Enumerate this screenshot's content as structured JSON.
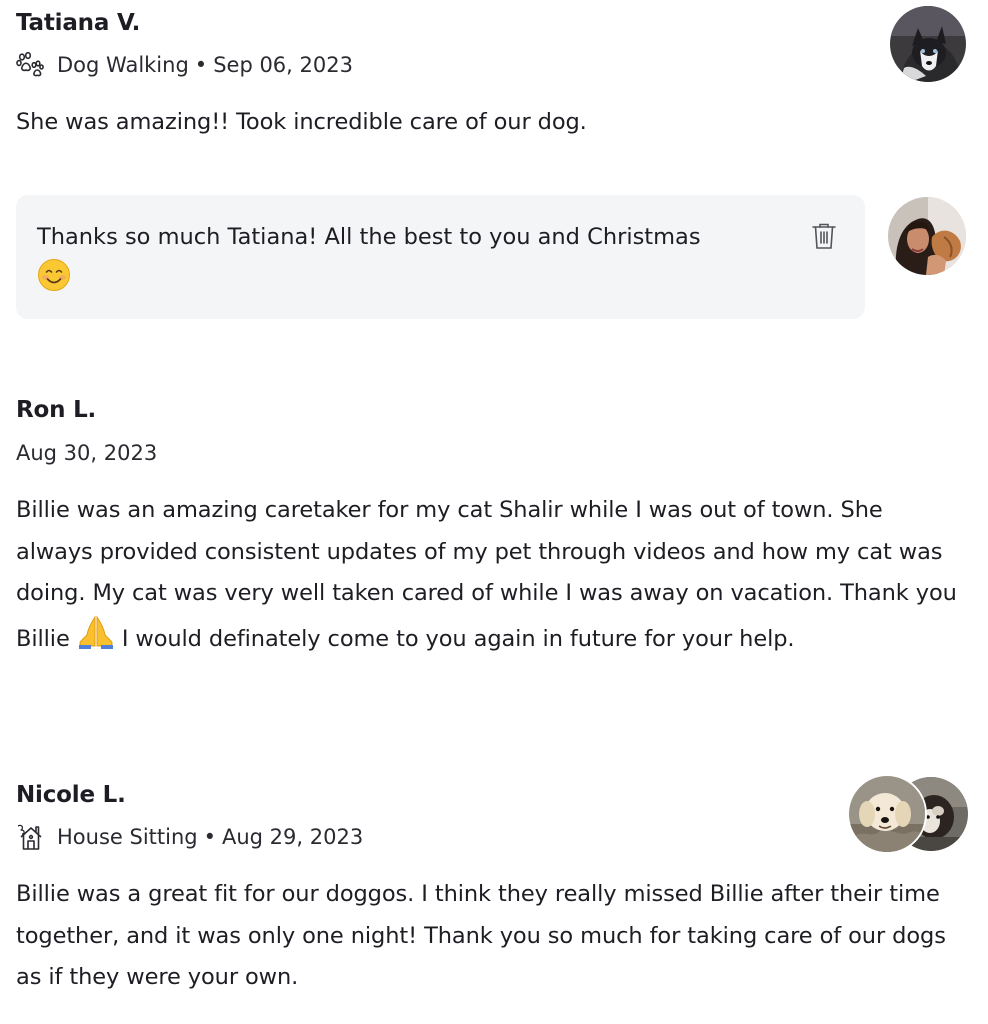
{
  "reviews": [
    {
      "name": "Tatiana V.",
      "service": "Dog Walking",
      "service_icon": "paw-icon",
      "date": "Sep 06, 2023",
      "text": "She was amazing!! Took incredible care of our dog.",
      "reply": {
        "text": "Thanks so much Tatiana! All the best to you and Christmas",
        "emoji": "smiling-face-emoji",
        "action_icon": "trash-icon"
      }
    },
    {
      "name": "Ron L.",
      "date": "Aug 30, 2023",
      "text_before_emoji": "Billie was an amazing caretaker for my cat Shalir while I was out of town. She always provided consistent updates of my pet through videos and how my cat was doing. My cat was very well taken cared of while I was away on vacation. Thank you Billie",
      "emoji": "folded-hands-emoji",
      "text_after_emoji": "I would definately come to you again in future for your help."
    },
    {
      "name": "Nicole L.",
      "service": "House Sitting",
      "service_icon": "house-icon",
      "date": "Aug 29, 2023",
      "text": "Billie was a great fit for our doggos. I think they really missed Billie after their time together, and it was only one night! Thank you so much for taking care of our dogs as if they were your own."
    }
  ],
  "separator": "•",
  "colors": {
    "text": "#1f1d24",
    "reply_background": "#f4f5f6",
    "icon_gray": "#6b6b73"
  }
}
